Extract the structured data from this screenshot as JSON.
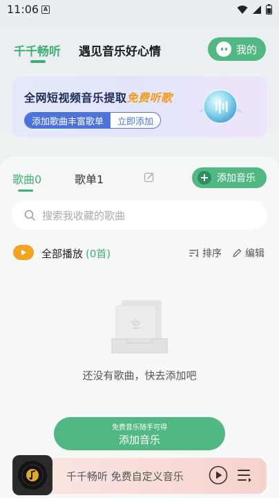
{
  "status_bar": {
    "time": "11:06"
  },
  "header": {
    "tab_main": "千千畅听",
    "tab_slogan": "遇见音乐好心情",
    "mine_button": "我的"
  },
  "banner": {
    "title_prefix": "全网短视频音乐提取",
    "title_free": "免费听歌",
    "pill_left": "添加歌曲丰富歌单",
    "pill_right": "立即添加"
  },
  "library": {
    "songs_tab": "歌曲0",
    "playlist_tab": "歌单1",
    "add_music": "添加音乐",
    "search_placeholder": "搜索我收藏的歌曲",
    "play_all": "全部播放",
    "play_all_count": "(0首)",
    "sort": "排序",
    "edit": "编辑",
    "empty_glyph": "空",
    "empty_text": "还没有歌曲，快去添加吧",
    "big_add_sub": "免费音乐随手可得",
    "big_add_main": "添加音乐"
  },
  "player": {
    "title": "千千畅听 免费自定义音乐"
  },
  "colors": {
    "accent_green": "#52b883",
    "text_green": "#3fae74",
    "banner_blue": "#4d72d9",
    "free_orange": "#f39a1b",
    "play_all_orange": "#f1a321"
  }
}
